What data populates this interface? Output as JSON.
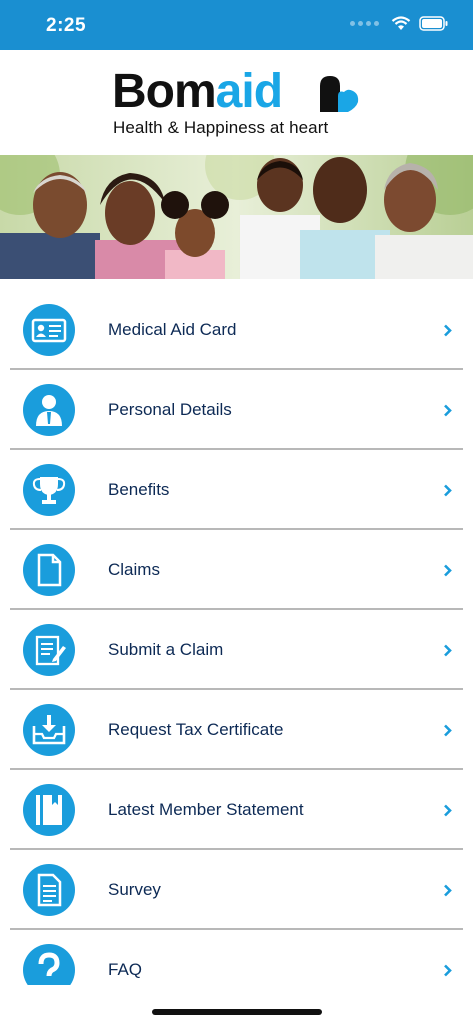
{
  "status_bar": {
    "time": "2:25"
  },
  "brand": {
    "name_part1": "Bom",
    "name_part2": "aid",
    "tagline": "Health & Happiness at heart",
    "accent_color": "#1aa6e6",
    "bar_color": "#1a8fd1"
  },
  "menu": {
    "items": [
      {
        "label": "Medical Aid Card",
        "icon": "id-card-icon"
      },
      {
        "label": "Personal Details",
        "icon": "person-icon"
      },
      {
        "label": "Benefits",
        "icon": "trophy-icon"
      },
      {
        "label": "Claims",
        "icon": "document-icon"
      },
      {
        "label": "Submit a Claim",
        "icon": "edit-document-icon"
      },
      {
        "label": "Request Tax Certificate",
        "icon": "download-tray-icon"
      },
      {
        "label": "Latest Member Statement",
        "icon": "book-icon"
      },
      {
        "label": "Survey",
        "icon": "list-document-icon"
      },
      {
        "label": "FAQ",
        "icon": "question-icon"
      }
    ]
  }
}
